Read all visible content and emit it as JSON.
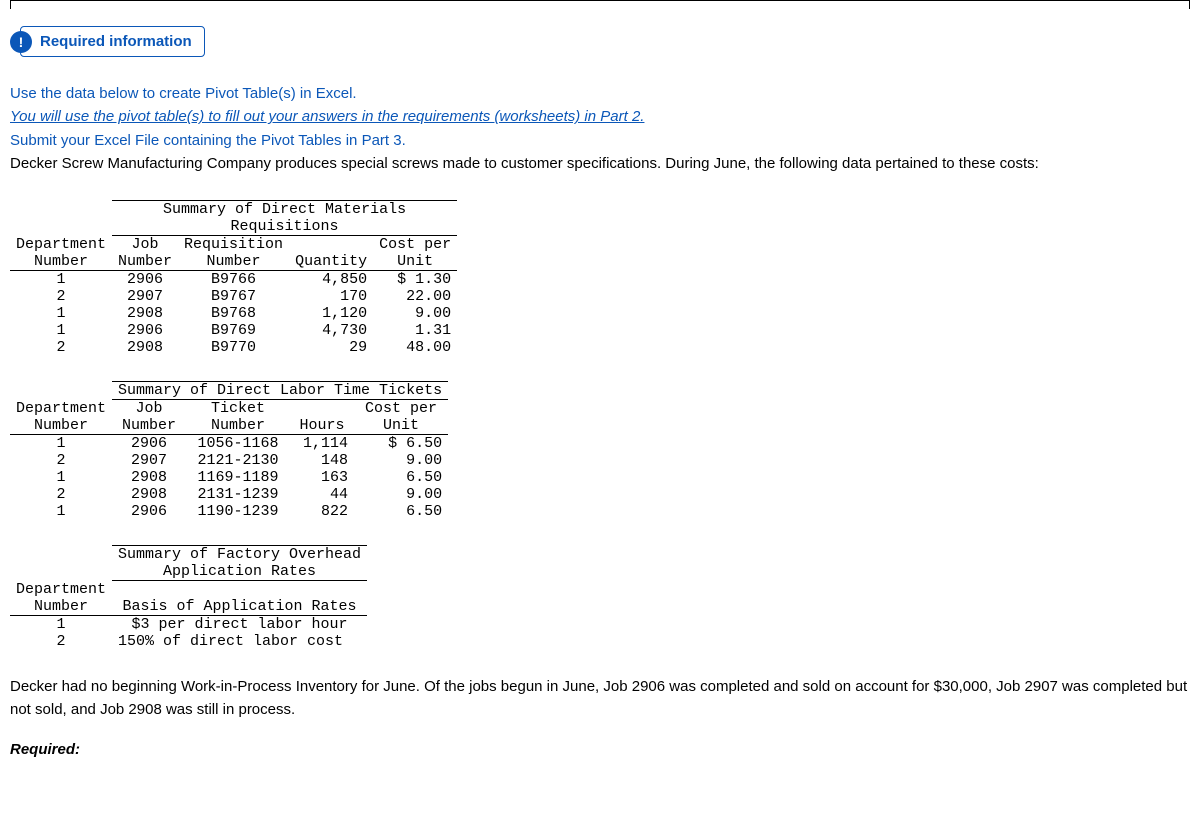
{
  "badge": {
    "icon": "!",
    "label": "Required information"
  },
  "instructions": {
    "l1": "Use the data below to create Pivot Table(s) in Excel.",
    "l2": "You will use the pivot table(s) to fill out your answers in the requirements (worksheets) in Part 2.",
    "l3": "Submit your Excel File containing the Pivot Tables in Part 3.",
    "l4": "Decker Screw Manufacturing Company produces special screws made to customer specifications. During June, the following data pertained to these costs:"
  },
  "materials": {
    "title1": "Summary of Direct Materials",
    "title2": "Requisitions",
    "headers": {
      "dept1": "Department",
      "dept2": "Number",
      "job1": "Job",
      "job2": "Number",
      "req1": "Requisition",
      "req2": "Number",
      "qty": "Quantity",
      "cost1": "Cost per",
      "cost2": "Unit"
    },
    "rows": [
      {
        "dept": "1",
        "job": "2906",
        "req": "B9766",
        "qty": "4,850",
        "cost": "$ 1.30"
      },
      {
        "dept": "2",
        "job": "2907",
        "req": "B9767",
        "qty": "170",
        "cost": "22.00"
      },
      {
        "dept": "1",
        "job": "2908",
        "req": "B9768",
        "qty": "1,120",
        "cost": "9.00"
      },
      {
        "dept": "1",
        "job": "2906",
        "req": "B9769",
        "qty": "4,730",
        "cost": "1.31"
      },
      {
        "dept": "2",
        "job": "2908",
        "req": "B9770",
        "qty": "29",
        "cost": "48.00"
      }
    ]
  },
  "labor": {
    "title": "Summary of Direct Labor Time Tickets",
    "headers": {
      "dept1": "Department",
      "dept2": "Number",
      "job1": "Job",
      "job2": "Number",
      "tick1": "Ticket",
      "tick2": "Number",
      "hours": "Hours",
      "cost1": "Cost per",
      "cost2": "Unit"
    },
    "rows": [
      {
        "dept": "1",
        "job": "2906",
        "tick": "1056-1168",
        "hours": "1,114",
        "cost": "$ 6.50"
      },
      {
        "dept": "2",
        "job": "2907",
        "tick": "2121-2130",
        "hours": "148",
        "cost": "9.00"
      },
      {
        "dept": "1",
        "job": "2908",
        "tick": "1169-1189",
        "hours": "163",
        "cost": "6.50"
      },
      {
        "dept": "2",
        "job": "2908",
        "tick": "2131-1239",
        "hours": "44",
        "cost": "9.00"
      },
      {
        "dept": "1",
        "job": "2906",
        "tick": "1190-1239",
        "hours": "822",
        "cost": "6.50"
      }
    ]
  },
  "overhead": {
    "title1": "Summary of Factory Overhead",
    "title2": "Application Rates",
    "headers": {
      "dept1": "Department",
      "dept2": "Number",
      "basis": "Basis of Application Rates"
    },
    "rows": [
      {
        "dept": "1",
        "basis": "$3 per direct labor hour"
      },
      {
        "dept": "2",
        "basis": "150% of direct labor cost"
      }
    ]
  },
  "conclusion": "Decker had no beginning Work-in-Process Inventory for June. Of the jobs begun in June, Job 2906 was completed and sold on account for $30,000, Job 2907 was completed but not sold, and Job 2908 was still in process.",
  "required_label": "Required:"
}
